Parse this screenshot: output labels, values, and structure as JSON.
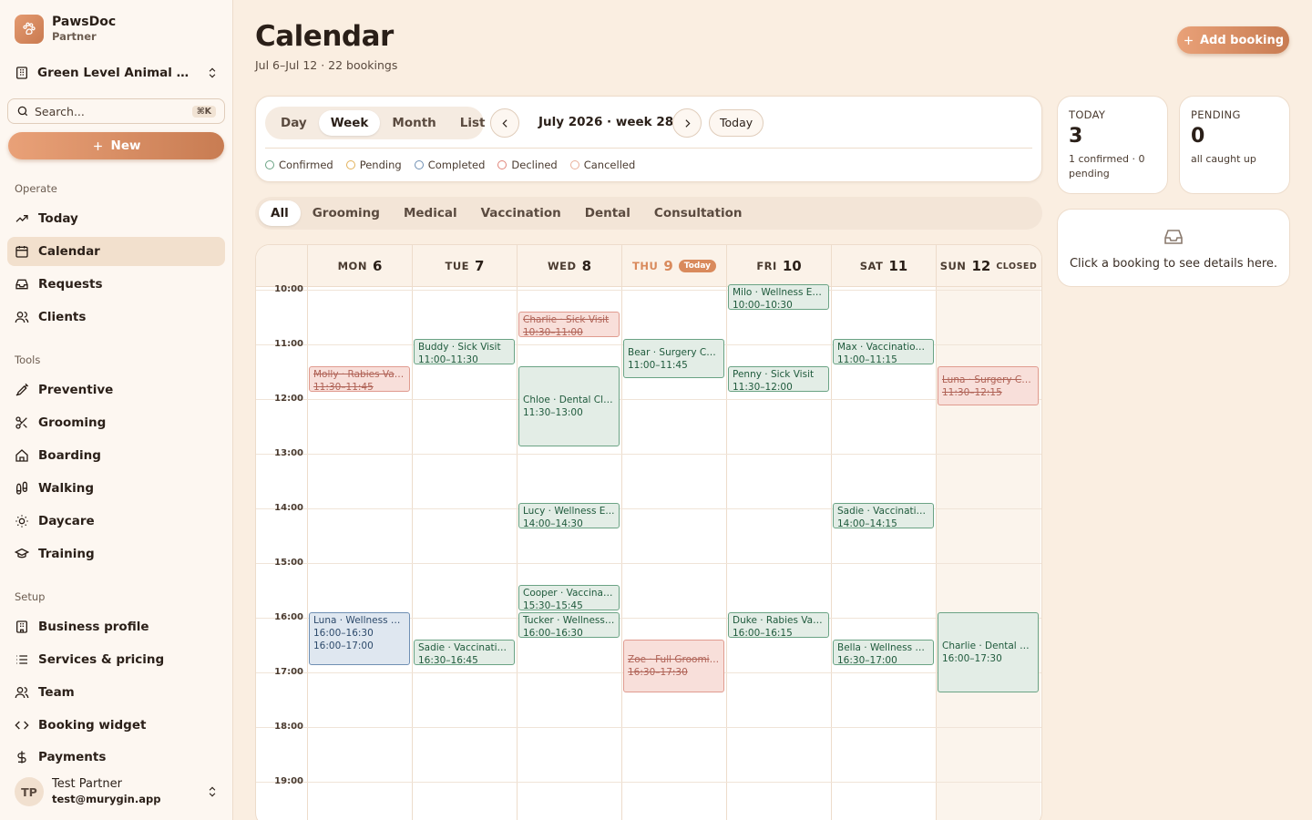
{
  "brand": {
    "name": "PawsDoc",
    "role": "Partner"
  },
  "org": {
    "name": "Green Level Animal Hos..."
  },
  "search": {
    "placeholder": "Search...",
    "shortcut": "⌘K"
  },
  "new_button": "New",
  "nav": {
    "operate_label": "Operate",
    "operate": [
      {
        "label": "Today",
        "icon": "trend-icon"
      },
      {
        "label": "Calendar",
        "icon": "calendar-icon",
        "active": true
      },
      {
        "label": "Requests",
        "icon": "inbox-icon"
      },
      {
        "label": "Clients",
        "icon": "users-icon"
      }
    ],
    "tools_label": "Tools",
    "tools": [
      {
        "label": "Preventive",
        "icon": "syringe-icon"
      },
      {
        "label": "Grooming",
        "icon": "scissors-icon"
      },
      {
        "label": "Boarding",
        "icon": "home-icon"
      },
      {
        "label": "Walking",
        "icon": "footprints-icon"
      },
      {
        "label": "Daycare",
        "icon": "sun-icon"
      },
      {
        "label": "Training",
        "icon": "graduation-cap-icon"
      }
    ],
    "setup_label": "Setup",
    "setup": [
      {
        "label": "Business profile",
        "icon": "building-icon"
      },
      {
        "label": "Services & pricing",
        "icon": "list-icon"
      },
      {
        "label": "Team",
        "icon": "team-icon"
      },
      {
        "label": "Booking widget",
        "icon": "code-icon"
      },
      {
        "label": "Payments",
        "icon": "dollar-icon"
      }
    ]
  },
  "user": {
    "initials": "TP",
    "name": "Test Partner",
    "email": "test@murygin.app"
  },
  "header": {
    "title": "Calendar",
    "subtitle": "Jul 6–Jul 12 · 22 bookings",
    "add_button": "Add booking"
  },
  "toolbar": {
    "views": [
      "Day",
      "Week",
      "Month",
      "List"
    ],
    "active_view": "Week",
    "period_label": "July 2026 · week 28",
    "today_button": "Today",
    "legend": [
      {
        "label": "Confirmed",
        "color": "#6aa384"
      },
      {
        "label": "Pending",
        "color": "#e2b15a"
      },
      {
        "label": "Completed",
        "color": "#6f8fb3"
      },
      {
        "label": "Declined",
        "color": "#e0857a"
      },
      {
        "label": "Cancelled",
        "color": "#e9b09a"
      }
    ]
  },
  "filters": {
    "items": [
      "All",
      "Grooming",
      "Medical",
      "Vaccination",
      "Dental",
      "Consultation"
    ],
    "active": "All"
  },
  "calendar": {
    "days": [
      {
        "name": "MON",
        "date": "6"
      },
      {
        "name": "TUE",
        "date": "7"
      },
      {
        "name": "WED",
        "date": "8"
      },
      {
        "name": "THU",
        "date": "9",
        "today": true,
        "badge": "Today"
      },
      {
        "name": "FRI",
        "date": "10"
      },
      {
        "name": "SAT",
        "date": "11"
      },
      {
        "name": "SUN",
        "date": "12",
        "closed": true,
        "badge": "CLOSED"
      }
    ],
    "hours": [
      "10:00",
      "11:00",
      "12:00",
      "13:00",
      "14:00",
      "15:00",
      "16:00",
      "17:00",
      "18:00",
      "19:00"
    ],
    "events": [
      {
        "day": 0,
        "title": "Molly · Rabies Vac...",
        "time": "11:30–11:45",
        "start": "11:30",
        "end": "11:45",
        "status": "declined"
      },
      {
        "day": 0,
        "title": "Luna · Wellness E...",
        "time": "16:00–16:30",
        "extra": "16:00–17:00",
        "start": "16:00",
        "end": "17:00",
        "status": "completed"
      },
      {
        "day": 1,
        "title": "Buddy · Sick Visit",
        "time": "11:00–11:30",
        "start": "11:00",
        "end": "11:30",
        "status": "confirmed"
      },
      {
        "day": 1,
        "title": "Sadie · Vaccinatio...",
        "time": "16:30–16:45",
        "start": "16:30",
        "end": "16:45",
        "status": "confirmed"
      },
      {
        "day": 2,
        "title": "Charlie · Sick Visit",
        "time": "10:30–11:00",
        "start": "10:30",
        "end": "11:00",
        "status": "declined"
      },
      {
        "day": 2,
        "title": "Chloe · Dental Cle...",
        "time": "11:30–13:00",
        "start": "11:30",
        "end": "13:00",
        "status": "confirmed"
      },
      {
        "day": 2,
        "title": "Lucy · Wellness E...",
        "time": "14:00–14:30",
        "start": "14:00",
        "end": "14:30",
        "status": "confirmed"
      },
      {
        "day": 2,
        "title": "Cooper · Vaccinati...",
        "time": "15:30–15:45",
        "start": "15:30",
        "end": "15:45",
        "status": "confirmed"
      },
      {
        "day": 2,
        "title": "Tucker · Wellness ...",
        "time": "16:00–16:30",
        "start": "16:00",
        "end": "16:30",
        "status": "confirmed"
      },
      {
        "day": 3,
        "title": "Bear · Surgery Co...",
        "time": "11:00–11:45",
        "start": "11:00",
        "end": "11:45",
        "status": "confirmed"
      },
      {
        "day": 3,
        "title": "Zoe · Full Groomin...",
        "time": "16:30–17:30",
        "start": "16:30",
        "end": "17:30",
        "status": "declined"
      },
      {
        "day": 4,
        "title": "Milo · Wellness Ex...",
        "time": "10:00–10:30",
        "start": "10:00",
        "end": "10:30",
        "status": "confirmed"
      },
      {
        "day": 4,
        "title": "Penny · Sick Visit",
        "time": "11:30–12:00",
        "start": "11:30",
        "end": "12:00",
        "status": "confirmed"
      },
      {
        "day": 4,
        "title": "Duke · Rabies Vac...",
        "time": "16:00–16:15",
        "start": "16:00",
        "end": "16:15",
        "status": "confirmed"
      },
      {
        "day": 5,
        "title": "Max · Vaccination ...",
        "time": "11:00–11:15",
        "start": "11:00",
        "end": "11:15",
        "status": "confirmed"
      },
      {
        "day": 5,
        "title": "Sadie · Vaccinatio...",
        "time": "14:00–14:15",
        "start": "14:00",
        "end": "14:15",
        "status": "confirmed"
      },
      {
        "day": 5,
        "title": "Bella · Wellness E...",
        "time": "16:30–17:00",
        "start": "16:30",
        "end": "17:00",
        "status": "confirmed"
      },
      {
        "day": 6,
        "title": "Luna · Surgery Co...",
        "time": "11:30–12:15",
        "start": "11:30",
        "end": "12:15",
        "status": "declined"
      },
      {
        "day": 6,
        "title": "Charlie · Dental Cl...",
        "time": "16:00–17:30",
        "start": "16:00",
        "end": "17:30",
        "status": "confirmed"
      }
    ]
  },
  "stats": {
    "today": {
      "label": "TODAY",
      "value": "3",
      "note": "1 confirmed · 0 pending"
    },
    "pending": {
      "label": "PENDING",
      "value": "0",
      "note": "all caught up"
    }
  },
  "detail_panel": {
    "text": "Click a booking to see details here."
  }
}
